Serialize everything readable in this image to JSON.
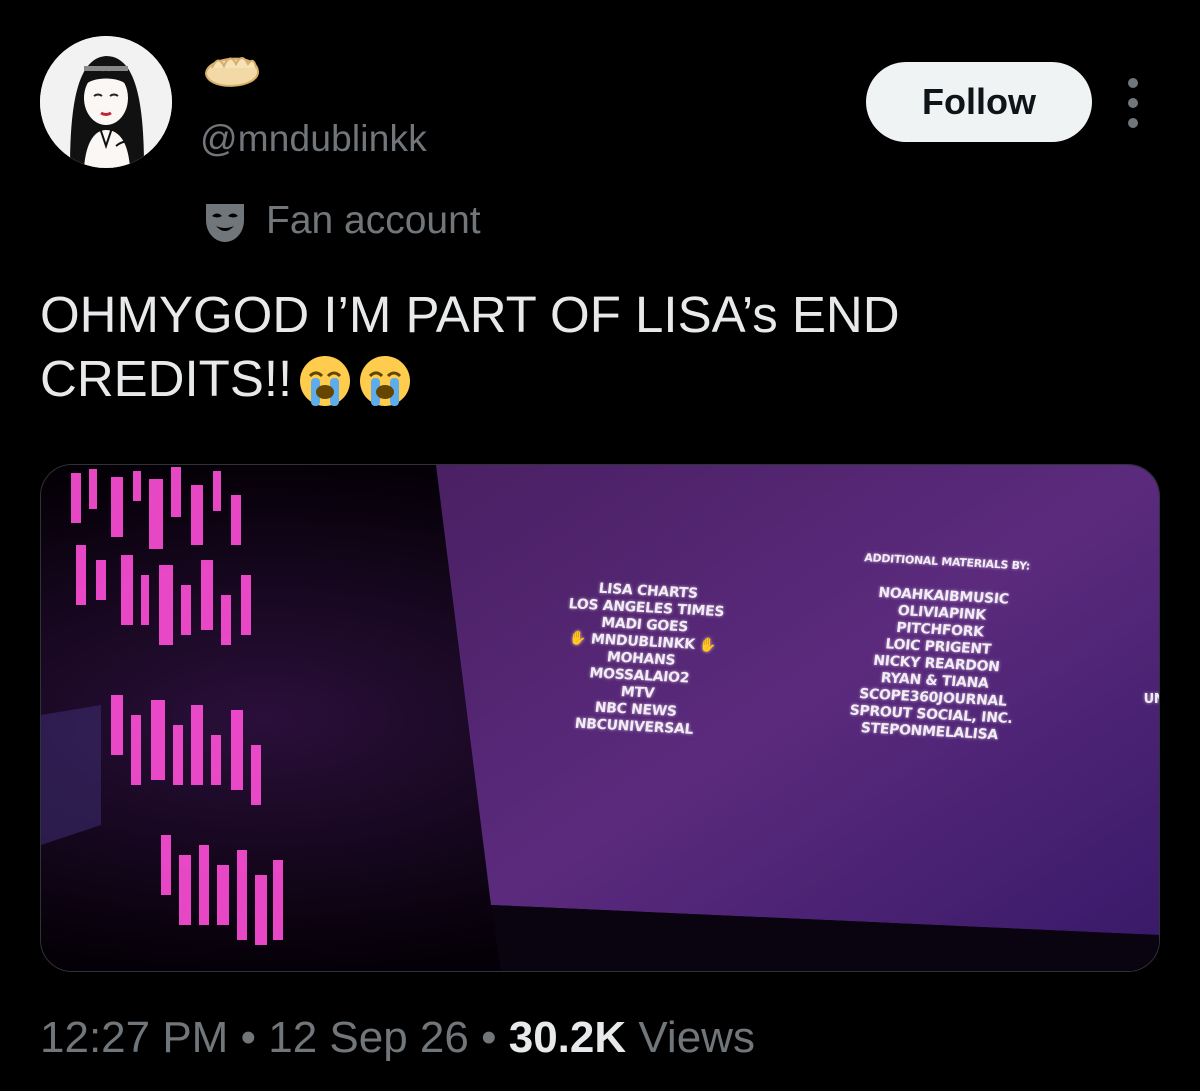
{
  "author": {
    "display_name_emoji": "dumpling-emoji",
    "username": "@mndublinkk",
    "badge_icon": "mask-icon",
    "badge_label": "Fan account"
  },
  "actions": {
    "follow_label": "Follow",
    "more_icon": "more-options-icon"
  },
  "tweet": {
    "text": "OHMYGOD I’M PART OF LISA’s END CREDITS!!",
    "trailing_emojis": [
      "loudly-crying-face-emoji",
      "loudly-crying-face-emoji"
    ]
  },
  "media": {
    "type": "photo",
    "credits_heading": "ADDITIONAL MATERIALS BY:",
    "left_column": [
      "LISA CHARTS",
      "LOS ANGELES TIMES",
      "MADI GOES",
      "MNDUBLINKK",
      "MOHANS",
      "MOSSALAIO2",
      "MTV",
      "NBC NEWS",
      "NBCUNIVERSAL"
    ],
    "right_column": [
      "NOAHKAIBMUSIC",
      "OLIVIAPINK",
      "PITCHFORK",
      "LOIC PRIGENT",
      "NICKY REARDON",
      "RYAN & TIANA",
      "SCOPE360JOURNAL",
      "SPROUT SOCIAL, INC.",
      "STEPONMELALISA"
    ],
    "edge_text": "UN"
  },
  "meta": {
    "time": "12:27 PM",
    "separator": "•",
    "date": "12 Sep 26",
    "views_count": "30.2K",
    "views_label": "Views"
  },
  "colors": {
    "background": "#000000",
    "primary_text": "#e7e9ea",
    "secondary_text": "#71767b",
    "follow_bg": "#eff3f4",
    "screen_purple": "#5a2a78",
    "neon_pink": "#ff4fd8"
  }
}
